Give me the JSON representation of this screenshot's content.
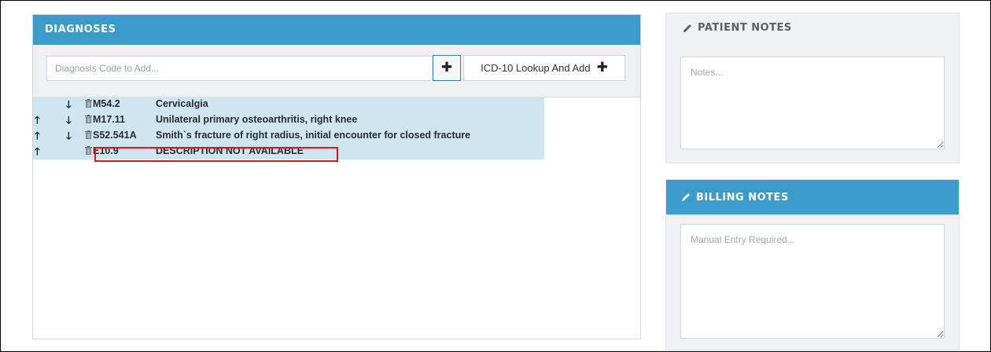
{
  "diagnoses": {
    "title": "DIAGNOSES",
    "code_input_placeholder": "Diagnosis Code to Add...",
    "add_button_icon": "plus-icon",
    "lookup_label": "ICD-10 Lookup And Add",
    "rows": [
      {
        "code": "M54.2",
        "description": "Cervicalgia",
        "up": false,
        "down": true
      },
      {
        "code": "M17.11",
        "description": "Unilateral primary osteoarthritis, right knee",
        "up": true,
        "down": true
      },
      {
        "code": "S52.541A",
        "description": "Smith`s fracture of right radius, initial encounter for closed fracture",
        "up": true,
        "down": true
      },
      {
        "code": "E10.9",
        "description": "DESCRIPTION NOT AVAILABLE",
        "up": true,
        "down": false
      }
    ]
  },
  "patient_notes": {
    "title": "PATIENT NOTES",
    "placeholder": "Notes..."
  },
  "billing_notes": {
    "title": "BILLING NOTES",
    "placeholder": "Manual Entry Required..."
  },
  "colors": {
    "header_blue": "#3b9ccc",
    "list_highlight": "#cfe6f1",
    "annotation_red": "#e01414"
  }
}
